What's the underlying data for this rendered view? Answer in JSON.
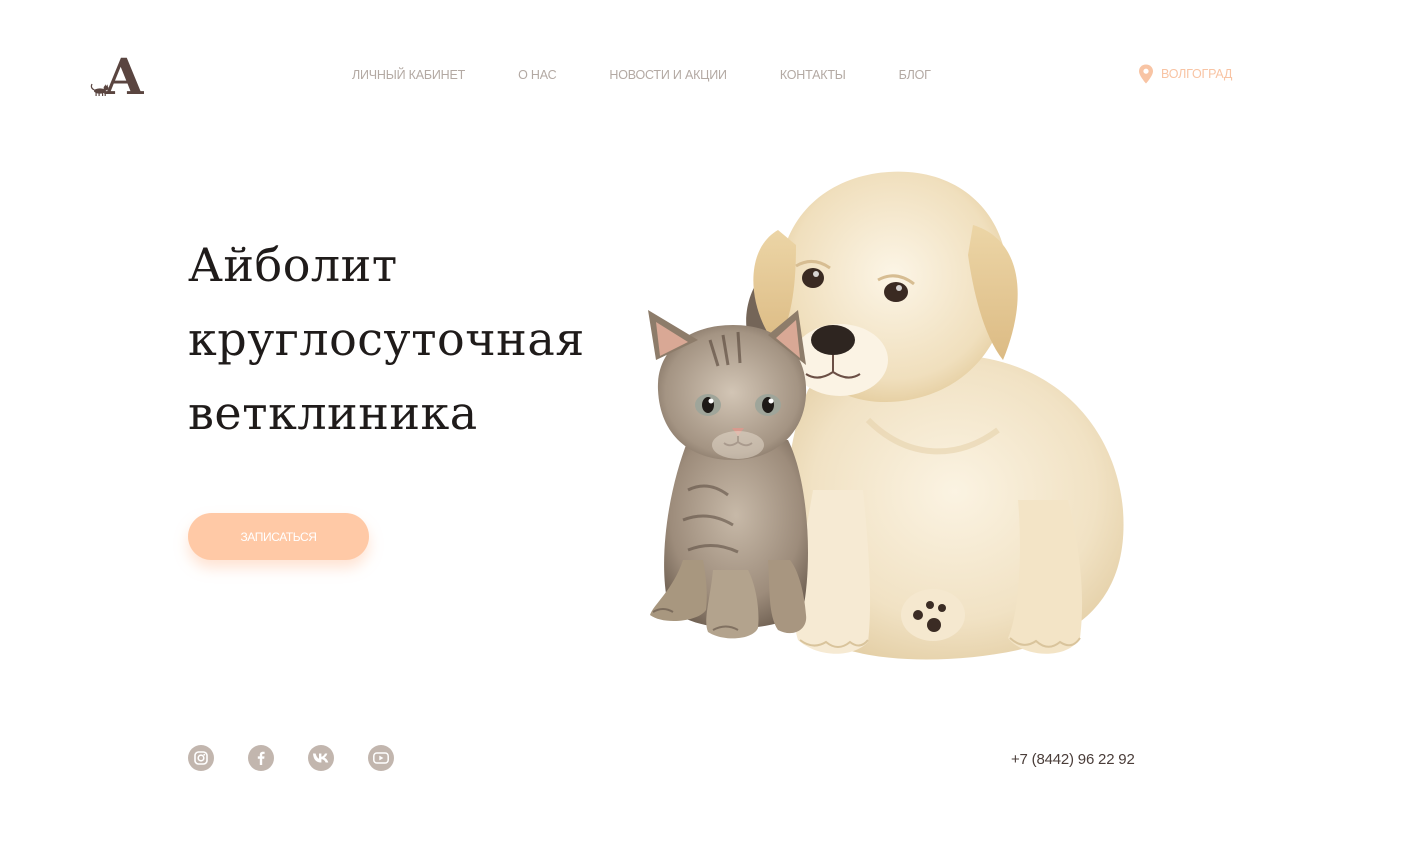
{
  "header": {
    "logo_letter": "A",
    "nav": [
      {
        "label": "ЛИЧНЫЙ КАБИНЕТ"
      },
      {
        "label": "О НАС"
      },
      {
        "label": "НОВОСТИ И АКЦИИ"
      },
      {
        "label": "КОНТАКТЫ"
      },
      {
        "label": "БЛОГ"
      }
    ],
    "city": "ВОЛГОГРАД",
    "city_icon": "map-pin-icon"
  },
  "hero": {
    "title_lines": [
      "Айболит",
      "круглосуточная",
      "ветклиника"
    ],
    "cta_label": "ЗАПИСАТЬСЯ",
    "image": "puppy-and-kitten-illustration"
  },
  "footer": {
    "socials": [
      {
        "icon": "instagram-icon"
      },
      {
        "icon": "facebook-icon"
      },
      {
        "icon": "vk-icon"
      },
      {
        "icon": "youtube-icon"
      }
    ],
    "phone": "+7 (8442) 96 22 92"
  },
  "colors": {
    "accent": "#ffc9a6",
    "city": "#f8c4a4",
    "nav_text": "#b3a9a3",
    "social_bg": "#c2b6ae",
    "title_text": "#1f1b1a",
    "logo": "#5a4540"
  }
}
